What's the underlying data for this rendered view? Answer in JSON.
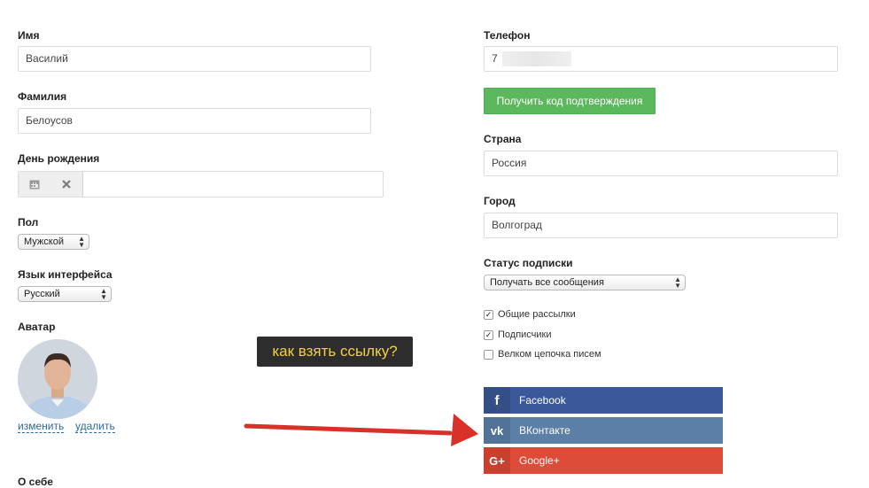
{
  "left": {
    "first_name": {
      "label": "Имя",
      "value": "Василий"
    },
    "last_name": {
      "label": "Фамилия",
      "value": "Белоусов"
    },
    "birthday": {
      "label": "День рождения",
      "value": ""
    },
    "gender": {
      "label": "Пол",
      "value": "Мужской"
    },
    "language": {
      "label": "Язык интерфейса",
      "value": "Русский"
    },
    "avatar": {
      "label": "Аватар",
      "change_link": "изменить",
      "delete_link": "удалить"
    },
    "about": {
      "label": "О себе"
    }
  },
  "right": {
    "phone": {
      "label": "Телефон",
      "value": "7"
    },
    "get_code_button": "Получить код подтверждения",
    "country": {
      "label": "Страна",
      "value": "Россия"
    },
    "city": {
      "label": "Город",
      "value": "Волгоград"
    },
    "subscription": {
      "label": "Статус подписки",
      "value": "Получать все сообщения"
    },
    "checkboxes": [
      {
        "label": "Общие рассылки",
        "checked": true
      },
      {
        "label": "Подписчики",
        "checked": true
      },
      {
        "label": "Велком цепочка писем",
        "checked": false
      }
    ],
    "social": [
      {
        "name": "Facebook",
        "icon": "f",
        "color": "#3b5998"
      },
      {
        "name": "ВКонтакте",
        "icon": "vk",
        "color": "#5b7fa6"
      },
      {
        "name": "Google+",
        "icon": "G+",
        "color": "#dd4b39"
      }
    ]
  },
  "annotation": {
    "text": "как взять ссылку?",
    "arrow_color": "#d9302a"
  },
  "colors": {
    "button_green": "#5cb85c",
    "tooltip_bg": "#2d2d2d",
    "tooltip_text": "#f5d13b"
  }
}
